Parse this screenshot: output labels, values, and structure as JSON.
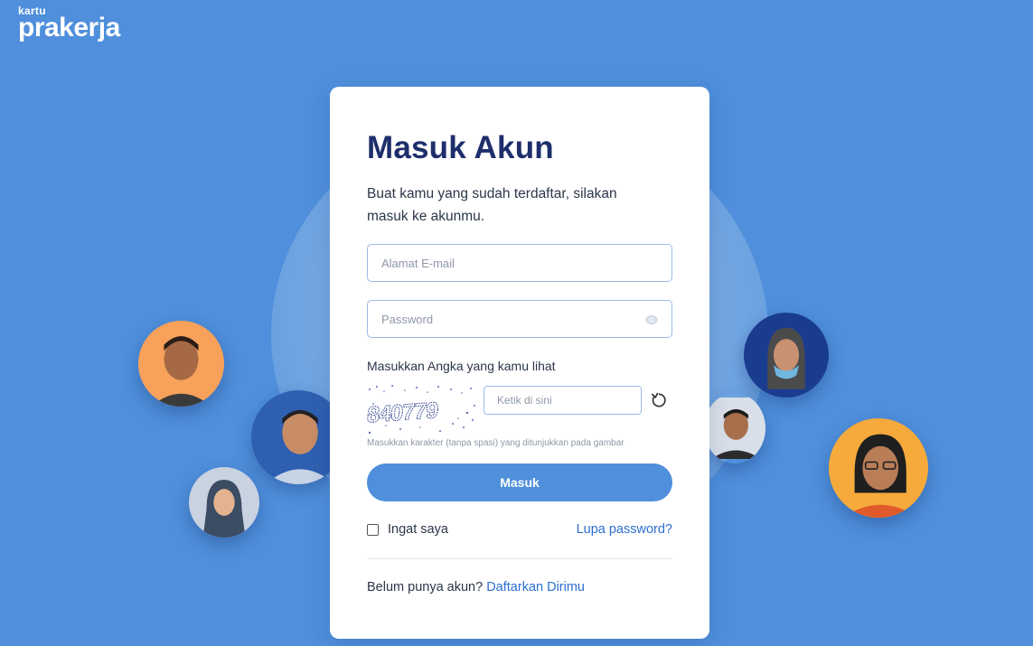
{
  "logo": {
    "small": "kartu",
    "main": "prakerja"
  },
  "login": {
    "title": "Masuk Akun",
    "subtitle": "Buat kamu yang sudah terdaftar, silakan masuk ke akunmu.",
    "email_placeholder": "Alamat E-mail",
    "password_placeholder": "Password",
    "captcha_label": "Masukkan Angka yang kamu lihat",
    "captcha_text": "840779",
    "captcha_placeholder": "Ketik di sini",
    "captcha_hint": "Masukkan karakter (tanpa spasi) yang ditunjukkan pada gambar",
    "submit_label": "Masuk",
    "remember_label": "Ingat saya",
    "forgot_label": "Lupa password?",
    "register_prompt": "Belum punya akun?",
    "register_link": "Daftarkan Dirimu"
  },
  "colors": {
    "background": "#4f8fdb",
    "primary": "#4f8fdb",
    "title": "#1e2e6b",
    "link": "#2d6fd0"
  },
  "icons": {
    "password_toggle": "eye-icon",
    "captcha_refresh": "refresh-icon"
  }
}
